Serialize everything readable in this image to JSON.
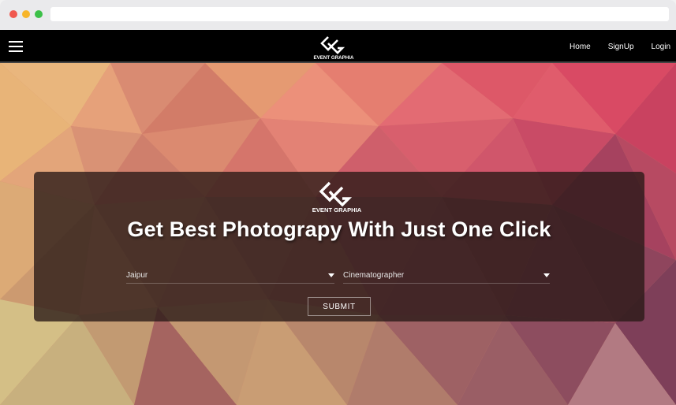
{
  "colors": {
    "navbar_bg": "#000000",
    "panel_bg": "rgba(40,24,22,0.78)",
    "text": "#ffffff"
  },
  "browser": {
    "controls": [
      "close-dot",
      "minimize-dot",
      "maximize-dot"
    ]
  },
  "navbar": {
    "menu_icon": "hamburger-icon",
    "logo": {
      "mark": "GG",
      "text": "EVENT GRAPHIA"
    },
    "links": [
      "Home",
      "SignUp",
      "Login"
    ]
  },
  "hero": {
    "logo": {
      "mark": "GG",
      "text": "EVENT GRAPHIA"
    },
    "headline": "Get Best Photograpy With Just One Click",
    "city_select": {
      "selected": "Jaipur"
    },
    "service_select": {
      "selected": "Cinematographer"
    },
    "submit_label": "SUBMIT"
  }
}
